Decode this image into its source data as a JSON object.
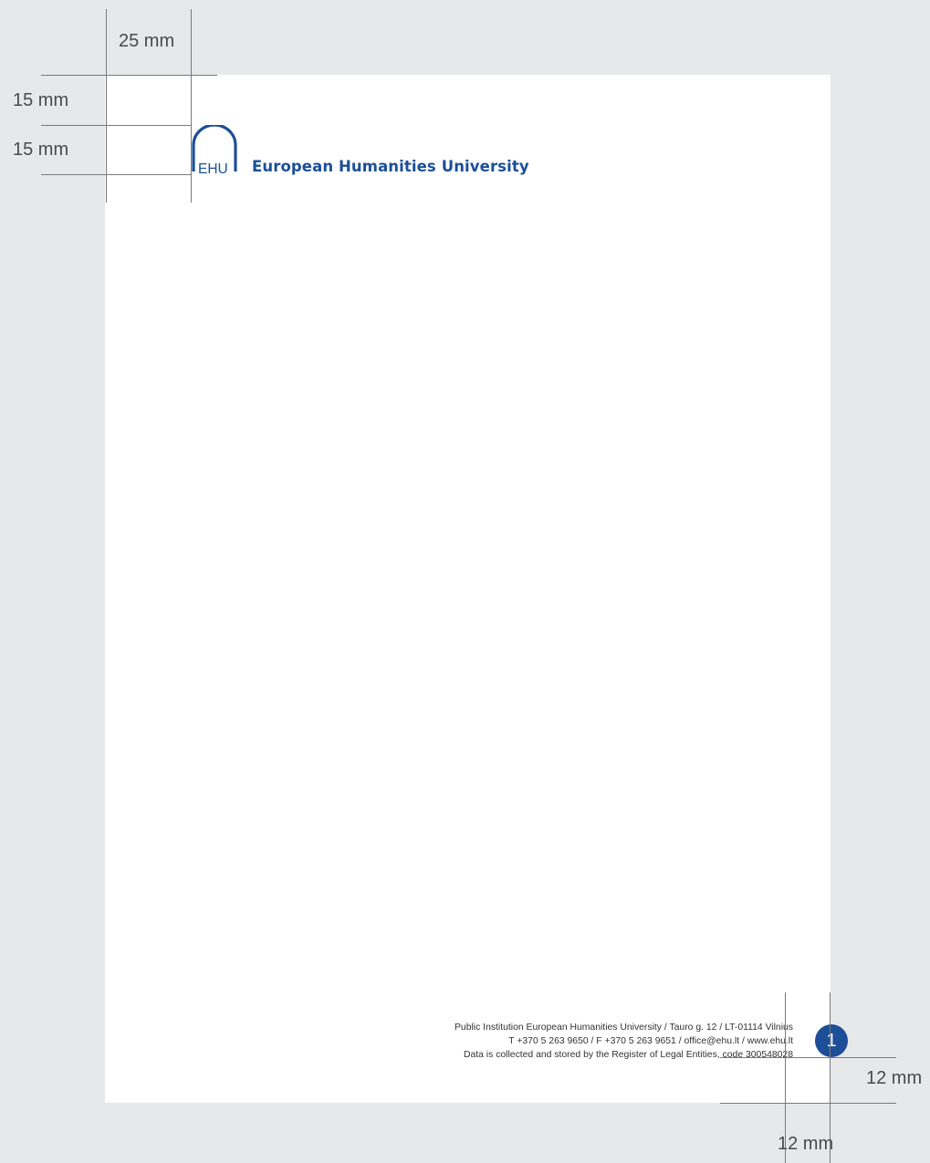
{
  "margins": {
    "left_label": "25 mm",
    "top_label": "15 mm",
    "logo_label": "15 mm",
    "bottom_right_label": "12 mm",
    "bottom_label": "12 mm"
  },
  "logo": {
    "monogram": "EHU",
    "wordmark": "European Humanities University",
    "color": "#1c4f97"
  },
  "footer": {
    "line1": "Public Institution European Humanities University  /  Tauro g. 12  /  LT-01114 Vilnius",
    "line2": "T +370 5 263 9650  /  F +370 5 263 9651  /  office@ehu.lt  /  www.ehu.lt",
    "line3": "Data is collected and stored by the Register of Legal Entities, code 300548028"
  },
  "page_number": "1"
}
